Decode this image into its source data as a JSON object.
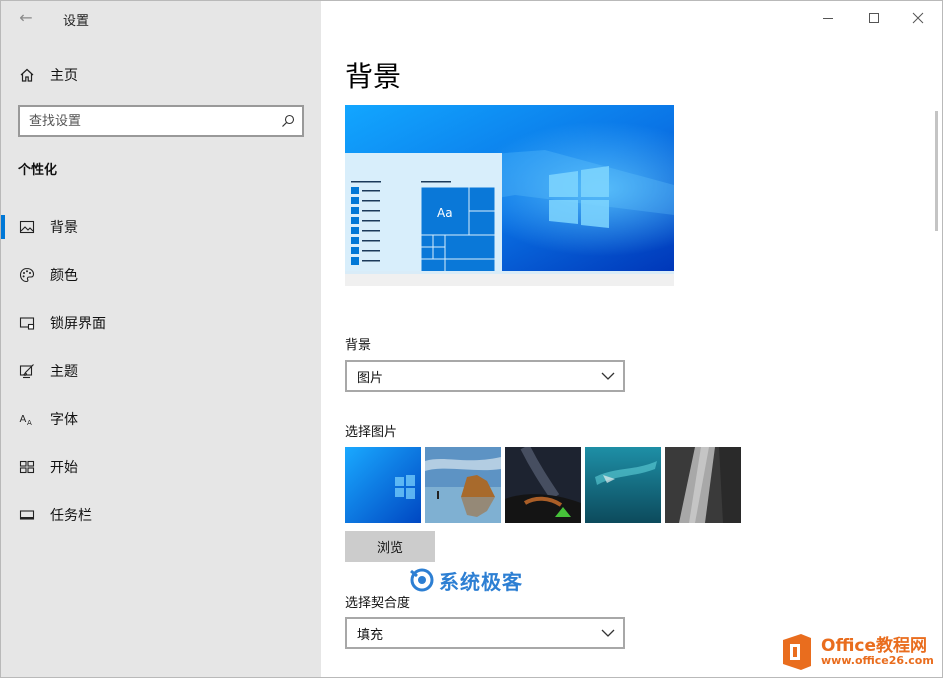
{
  "window": {
    "title": "设置",
    "controls": [
      "minimize",
      "maximize",
      "close"
    ]
  },
  "sidebar": {
    "home_label": "主页",
    "search_placeholder": "查找设置",
    "section_title": "个性化",
    "items": [
      {
        "label": "背景",
        "icon": "picture-icon",
        "selected": true
      },
      {
        "label": "颜色",
        "icon": "palette-icon",
        "selected": false
      },
      {
        "label": "锁屏界面",
        "icon": "lock-screen-icon",
        "selected": false
      },
      {
        "label": "主题",
        "icon": "theme-brush-icon",
        "selected": false
      },
      {
        "label": "字体",
        "icon": "font-icon",
        "selected": false
      },
      {
        "label": "开始",
        "icon": "start-grid-icon",
        "selected": false
      },
      {
        "label": "任务栏",
        "icon": "taskbar-icon",
        "selected": false
      }
    ]
  },
  "main": {
    "page_title": "背景",
    "preview_sample_text": "Aa",
    "background_label": "背景",
    "background_value": "图片",
    "choose_picture_label": "选择图片",
    "browse_label": "浏览",
    "fit_label": "选择契合度",
    "fit_value": "填充"
  },
  "watermarks": {
    "site1": "系统极客",
    "site2_line1": "Office教程网",
    "site2_line2": "www.office26.com"
  },
  "colors": {
    "accent": "#0078d7",
    "sidebar_bg": "#e6e6e6",
    "watermark_blue": "#2d7fd3",
    "watermark_orange": "#e96d1e"
  }
}
